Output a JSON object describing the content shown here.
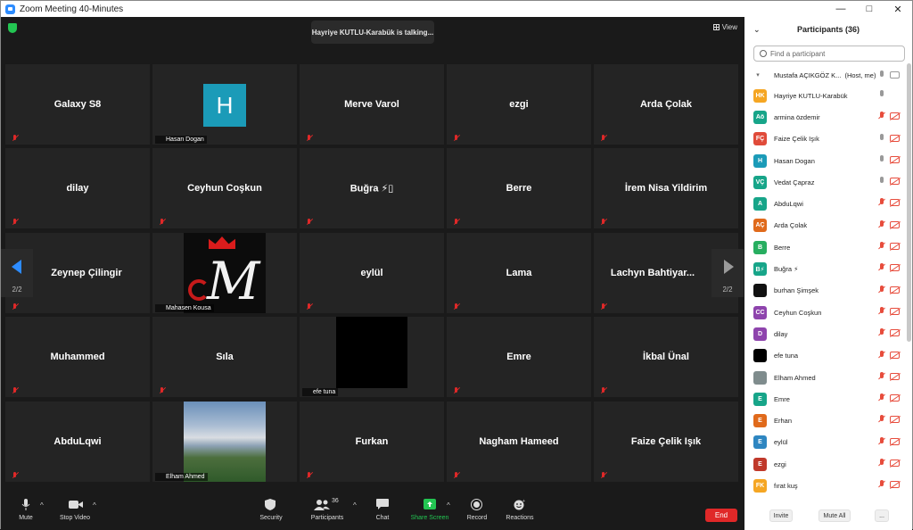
{
  "window": {
    "title": "Zoom Meeting 40-Minutes",
    "controls": [
      "—",
      "□",
      "✕"
    ]
  },
  "meeting": {
    "talking_banner": "Hayriye KUTLU-Karabük is talking...",
    "view_label": "View",
    "page_indicator": "2/2",
    "tiles": [
      {
        "name": "Galaxy S8",
        "label": ""
      },
      {
        "name": "",
        "label": "Hasan Dogan",
        "avatar": "H"
      },
      {
        "name": "Merve Varol",
        "label": ""
      },
      {
        "name": "ezgi",
        "label": ""
      },
      {
        "name": "Arda Çolak",
        "label": ""
      },
      {
        "name": "dilay",
        "label": ""
      },
      {
        "name": "Ceyhun Coşkun",
        "label": ""
      },
      {
        "name": "Buğra ⚡▯",
        "label": ""
      },
      {
        "name": "Berre",
        "label": ""
      },
      {
        "name": "İrem Nisa Yildirim",
        "label": ""
      },
      {
        "name": "Zeynep Çilingir",
        "label": ""
      },
      {
        "name": "",
        "label": "Mahasen Kousa"
      },
      {
        "name": "eylül",
        "label": ""
      },
      {
        "name": "Lama",
        "label": ""
      },
      {
        "name": "Lachyn  Bahtiyar...",
        "label": ""
      },
      {
        "name": "Muhammed",
        "label": ""
      },
      {
        "name": "Sıla",
        "label": ""
      },
      {
        "name": "",
        "label": "efe tuna"
      },
      {
        "name": "Emre",
        "label": ""
      },
      {
        "name": "İkbal Ünal",
        "label": ""
      },
      {
        "name": "AbduLqwi",
        "label": ""
      },
      {
        "name": "",
        "label": "Elham Ahmed"
      },
      {
        "name": "Furkan",
        "label": ""
      },
      {
        "name": "Nagham Hameed",
        "label": ""
      },
      {
        "name": "Faize Çelik Işık",
        "label": ""
      }
    ]
  },
  "toolbar": {
    "mute": "Mute",
    "stop_video": "Stop Video",
    "security": "Security",
    "participants": "Participants",
    "participants_count": "36",
    "chat": "Chat",
    "share_screen": "Share Screen",
    "record": "Record",
    "reactions": "Reactions",
    "end": "End"
  },
  "panel": {
    "title": "Participants (36)",
    "search_placeholder": "Find a participant",
    "host_name": "Mustafa AÇIKGÖZ K...",
    "host_tag": "(Host, me)",
    "participants": [
      {
        "initials": "HK",
        "name": "Hayriye KUTLU-Karabük",
        "color": "#f5a623",
        "mic": "on",
        "video": "none"
      },
      {
        "initials": "Aö",
        "name": "armina özdemir",
        "color": "#17a589",
        "mic": "off",
        "video": "off"
      },
      {
        "initials": "FÇ",
        "name": "Faize Çelik Işık",
        "color": "#e04b3a",
        "mic": "on",
        "video": "off"
      },
      {
        "initials": "H",
        "name": "Hasan Dogan",
        "color": "#1b9bb8",
        "mic": "on",
        "video": "off"
      },
      {
        "initials": "VÇ",
        "name": "Vedat Çapraz",
        "color": "#17a589",
        "mic": "on",
        "video": "off"
      },
      {
        "initials": "A",
        "name": "AbduLqwi",
        "color": "#17a589",
        "mic": "off",
        "video": "off"
      },
      {
        "initials": "AÇ",
        "name": "Arda Çolak",
        "color": "#e06a1b",
        "mic": "off",
        "video": "off"
      },
      {
        "initials": "B",
        "name": "Berre",
        "color": "#27ae60",
        "mic": "off",
        "video": "off"
      },
      {
        "initials": "B⚡",
        "name": "Buğra ⚡",
        "color": "#17a589",
        "mic": "off",
        "video": "off"
      },
      {
        "initials": "",
        "name": "burhan Şimşek",
        "color": "#111111",
        "mic": "off",
        "video": "off"
      },
      {
        "initials": "CC",
        "name": "Ceyhun Coşkun",
        "color": "#8e44ad",
        "mic": "off",
        "video": "off"
      },
      {
        "initials": "D",
        "name": "dilay",
        "color": "#8e44ad",
        "mic": "off",
        "video": "off"
      },
      {
        "initials": "",
        "name": "efe tuna",
        "color": "#000000",
        "mic": "off",
        "video": "off"
      },
      {
        "initials": "",
        "name": "Elham Ahmed",
        "color": "#7f8c8d",
        "mic": "off",
        "video": "off"
      },
      {
        "initials": "E",
        "name": "Emre",
        "color": "#17a589",
        "mic": "off",
        "video": "off"
      },
      {
        "initials": "E",
        "name": "Erhan",
        "color": "#e06a1b",
        "mic": "off",
        "video": "off"
      },
      {
        "initials": "E",
        "name": "eylül",
        "color": "#2e86c1",
        "mic": "off",
        "video": "off"
      },
      {
        "initials": "E",
        "name": "ezgi",
        "color": "#c0392b",
        "mic": "off",
        "video": "off"
      },
      {
        "initials": "FK",
        "name": "fırat kuş",
        "color": "#f5a623",
        "mic": "off",
        "video": "off"
      }
    ],
    "invite": "Invite",
    "mute_all": "Mute All",
    "more": "..."
  },
  "colors": {
    "accent": "#2d8cff",
    "end": "#e02828",
    "share": "#23c552"
  }
}
